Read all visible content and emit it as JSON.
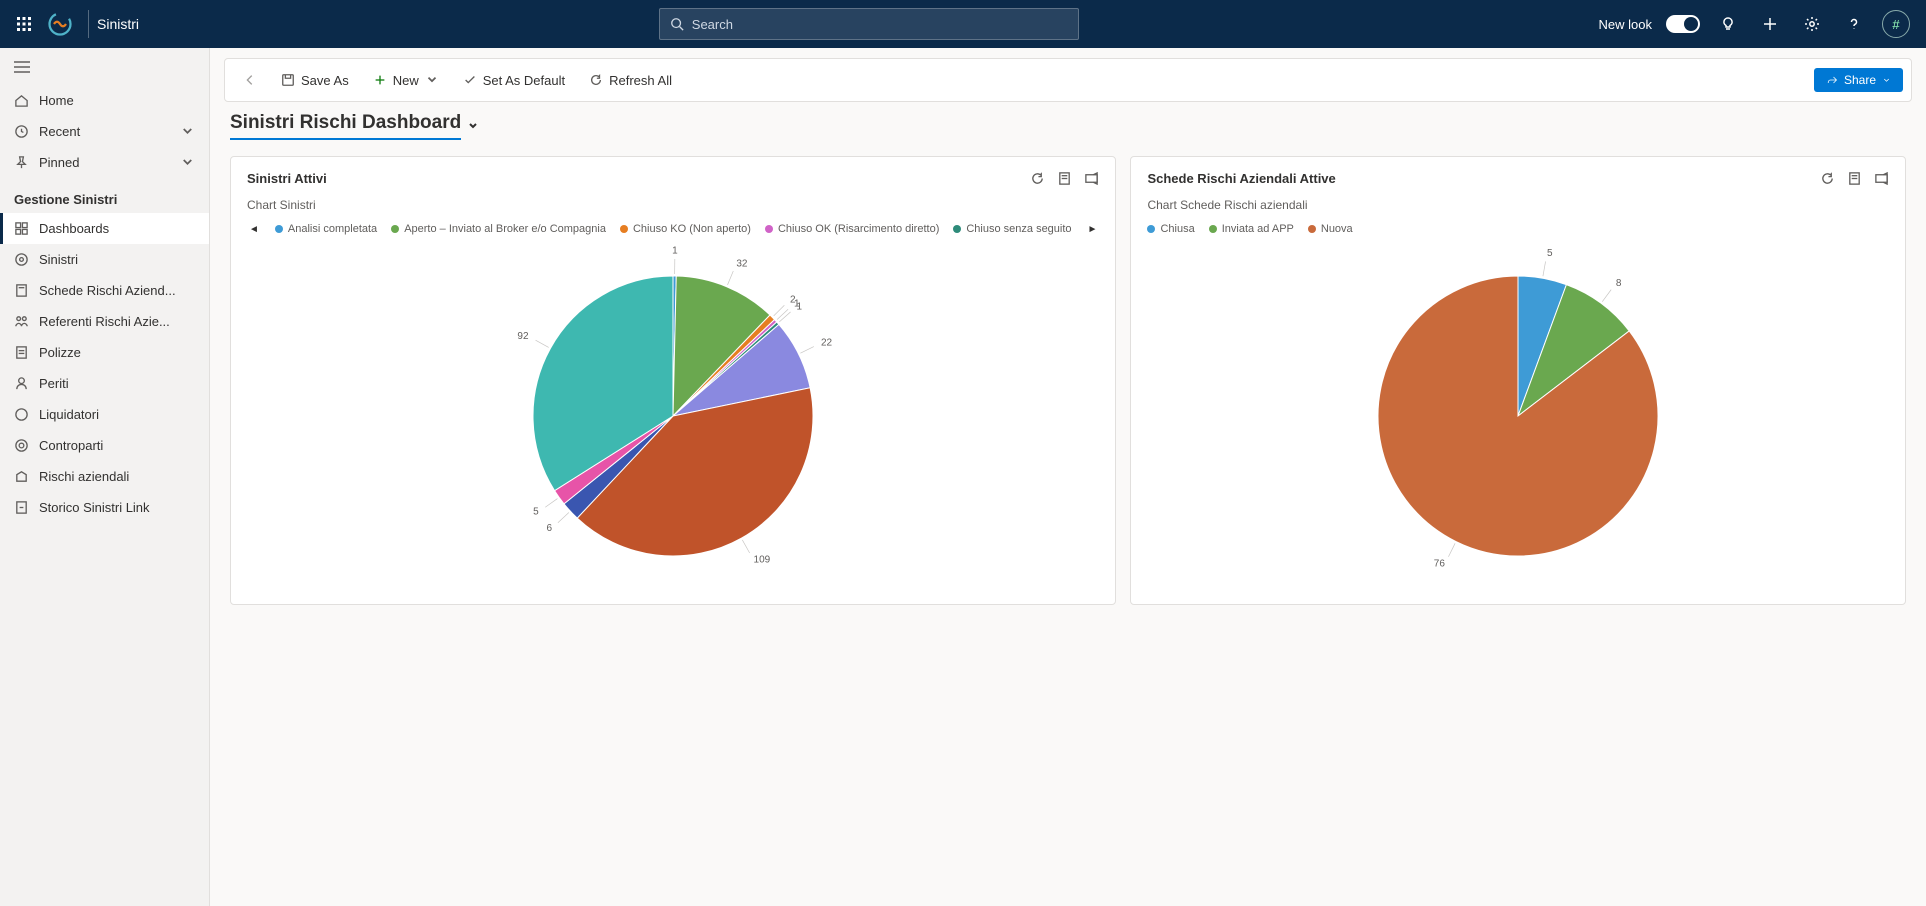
{
  "app_title": "Sinistri",
  "search_placeholder": "Search",
  "topbar": {
    "new_look_label": "New look",
    "avatar_initial": "#"
  },
  "sidebar": {
    "home": "Home",
    "recent": "Recent",
    "pinned": "Pinned",
    "section": "Gestione Sinistri",
    "items": [
      "Dashboards",
      "Sinistri",
      "Schede Rischi Aziend...",
      "Referenti Rischi Azie...",
      "Polizze",
      "Periti",
      "Liquidatori",
      "Controparti",
      "Rischi aziendali",
      "Storico Sinistri Link"
    ]
  },
  "toolbar": {
    "save_as": "Save As",
    "new": "New",
    "set_default": "Set As Default",
    "refresh": "Refresh All",
    "share": "Share"
  },
  "page_title": "Sinistri Rischi Dashboard",
  "card1": {
    "title": "Sinistri Attivi",
    "subtitle": "Chart Sinistri"
  },
  "card2": {
    "title": "Schede Rischi Aziendali Attive",
    "subtitle": "Chart Schede Rischi aziendali"
  },
  "chart_data": [
    {
      "type": "pie",
      "title": "Sinistri Attivi",
      "subtitle": "Chart Sinistri",
      "series": [
        {
          "name": "Analisi completata",
          "value": 1,
          "color": "#3e9bd6"
        },
        {
          "name": "Aperto – Inviato al Broker e/o Compagnia",
          "value": 32,
          "color": "#6aa84f"
        },
        {
          "name": "Chiuso KO (Non aperto)",
          "value": 2,
          "color": "#e67e22"
        },
        {
          "name": "Chiuso OK (Risarcimento diretto)",
          "value": 1,
          "color": "#d063c7"
        },
        {
          "name": "Chiuso senza seguito",
          "value": 1,
          "color": "#2e8b7a"
        },
        {
          "name": "",
          "value": 22,
          "color": "#8a89e0"
        },
        {
          "name": "",
          "value": 109,
          "color": "#c0532a"
        },
        {
          "name": "",
          "value": 6,
          "color": "#3a56b0"
        },
        {
          "name": "",
          "value": 5,
          "color": "#e754a8"
        },
        {
          "name": "",
          "value": 92,
          "color": "#3eb8b0"
        }
      ],
      "legend_truncated": true
    },
    {
      "type": "pie",
      "title": "Schede Rischi Aziendali Attive",
      "subtitle": "Chart Schede Rischi aziendali",
      "series": [
        {
          "name": "Chiusa",
          "value": 5,
          "color": "#3e9bd6"
        },
        {
          "name": "Inviata ad APP",
          "value": 8,
          "color": "#6aa84f"
        },
        {
          "name": "Nuova",
          "value": 76,
          "color": "#c96a3b"
        }
      ]
    }
  ]
}
